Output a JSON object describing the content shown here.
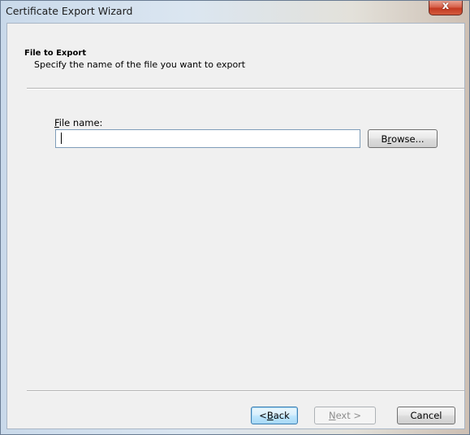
{
  "window": {
    "title": "Certificate Export Wizard",
    "close_glyph": "x",
    "close_icon": "close-icon"
  },
  "header": {
    "title": "File to Export",
    "subtitle": "Specify the name of the file you want to export"
  },
  "form": {
    "file_label_accel": "F",
    "file_label_rest": "ile name:",
    "file_value": "",
    "browse_accel_pre": "B",
    "browse_accel": "r",
    "browse_rest": "owse..."
  },
  "footer": {
    "back_pre": "< ",
    "back_accel": "B",
    "back_rest": "ack",
    "next_accel": "N",
    "next_rest": "ext >",
    "cancel": "Cancel"
  },
  "colors": {
    "dialog_bg": "#f0f0f0",
    "close_red": "#c33a22"
  }
}
